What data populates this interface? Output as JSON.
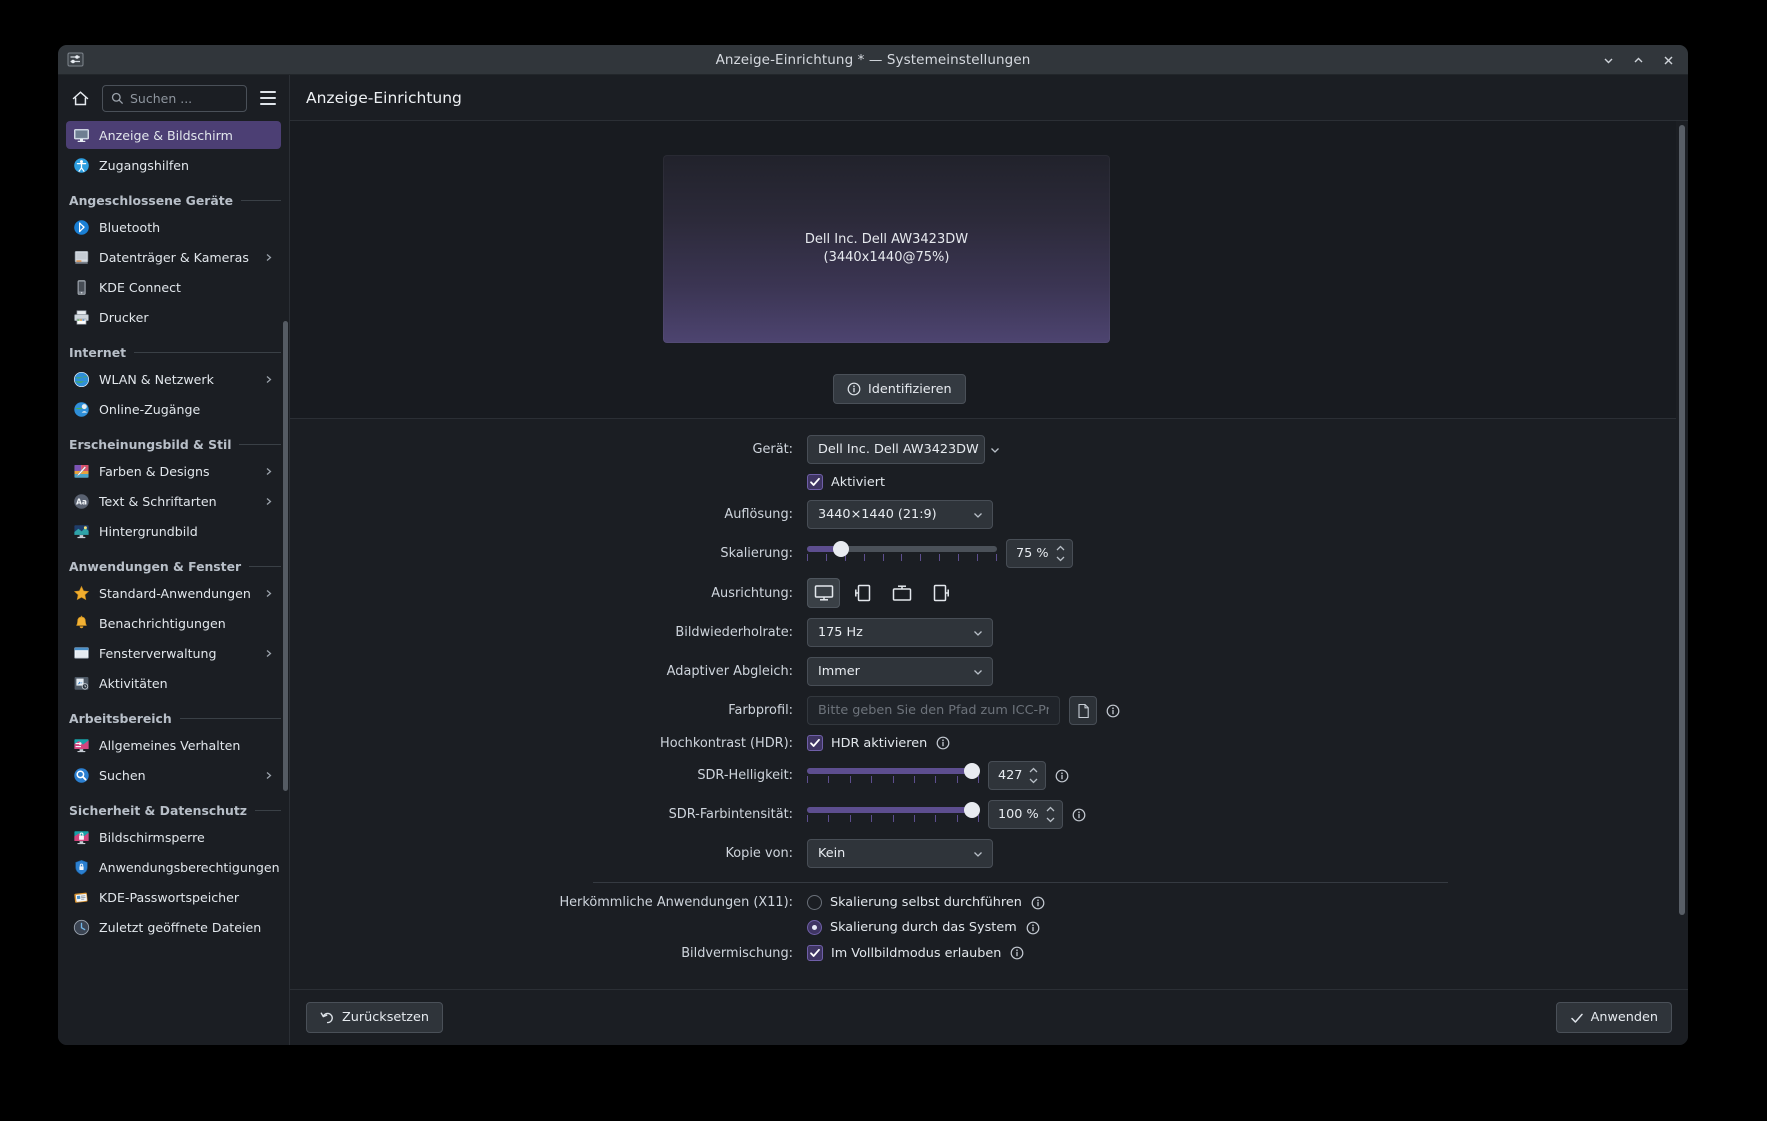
{
  "window": {
    "title": "Anzeige-Einrichtung * — Systemeinstellungen",
    "app_icon": "settings-sliders-icon",
    "controls": {
      "minimize": "minimize-icon",
      "maximize": "maximize-icon",
      "close": "close-icon"
    }
  },
  "sidebar": {
    "home_icon": "home-icon",
    "search": {
      "placeholder": "Suchen ...",
      "icon": "search-icon"
    },
    "menu_icon": "hamburger-menu-icon",
    "groups": [
      {
        "label": null,
        "items": [
          {
            "label": "Anzeige & Bildschirm",
            "icon": "monitor-icon",
            "active": true,
            "chevron": false
          },
          {
            "label": "Zugangshilfen",
            "icon": "accessibility-icon",
            "active": false,
            "chevron": false
          }
        ]
      },
      {
        "label": "Angeschlossene Geräte",
        "items": [
          {
            "label": "Bluetooth",
            "icon": "bluetooth-icon",
            "active": false,
            "chevron": false
          },
          {
            "label": "Datenträger & Kameras",
            "icon": "removable-media-icon",
            "active": false,
            "chevron": true
          },
          {
            "label": "KDE Connect",
            "icon": "smartphone-icon",
            "active": false,
            "chevron": false
          },
          {
            "label": "Drucker",
            "icon": "printer-icon",
            "active": false,
            "chevron": false
          }
        ]
      },
      {
        "label": "Internet",
        "items": [
          {
            "label": "WLAN & Netzwerk",
            "icon": "globe-network-icon",
            "active": false,
            "chevron": true
          },
          {
            "label": "Online-Zugänge",
            "icon": "online-accounts-icon",
            "active": false,
            "chevron": false
          }
        ]
      },
      {
        "label": "Erscheinungsbild & Stil",
        "items": [
          {
            "label": "Farben & Designs",
            "icon": "color-palette-icon",
            "active": false,
            "chevron": true
          },
          {
            "label": "Text & Schriftarten",
            "icon": "font-aa-icon",
            "active": false,
            "chevron": true
          },
          {
            "label": "Hintergrundbild",
            "icon": "wallpaper-icon",
            "active": false,
            "chevron": false
          }
        ]
      },
      {
        "label": "Anwendungen & Fenster",
        "items": [
          {
            "label": "Standard-Anwendungen",
            "icon": "star-icon",
            "active": false,
            "chevron": true
          },
          {
            "label": "Benachrichtigungen",
            "icon": "bell-icon",
            "active": false,
            "chevron": false
          },
          {
            "label": "Fensterverwaltung",
            "icon": "window-icon",
            "active": false,
            "chevron": true
          },
          {
            "label": "Aktivitäten",
            "icon": "activities-icon",
            "active": false,
            "chevron": false
          }
        ]
      },
      {
        "label": "Arbeitsbereich",
        "items": [
          {
            "label": "Allgemeines Verhalten",
            "icon": "workspace-behavior-icon",
            "active": false,
            "chevron": false
          },
          {
            "label": "Suchen",
            "icon": "magnifier-icon",
            "active": false,
            "chevron": true
          }
        ]
      },
      {
        "label": "Sicherheit & Datenschutz",
        "items": [
          {
            "label": "Bildschirmsperre",
            "icon": "screen-lock-icon",
            "active": false,
            "chevron": false
          },
          {
            "label": "Anwendungsberechtigungen",
            "icon": "shield-lock-icon",
            "active": false,
            "chevron": false
          },
          {
            "label": "KDE-Passwortspeicher",
            "icon": "wallet-icon",
            "active": false,
            "chevron": false
          },
          {
            "label": "Zuletzt geöffnete Dateien",
            "icon": "recent-clock-icon",
            "active": false,
            "chevron": false
          }
        ]
      }
    ]
  },
  "main": {
    "page_title": "Anzeige-Einrichtung",
    "preview": {
      "monitor_name": "Dell Inc. Dell AW3423DW",
      "monitor_mode": "(3440x1440@75%)"
    },
    "identify_button": {
      "label": "Identifizieren",
      "icon": "info-circle-icon"
    },
    "form": {
      "device": {
        "label": "Gerät:",
        "value": "Dell Inc. Dell AW3423DW"
      },
      "enabled": {
        "label": "Aktiviert",
        "checked": true
      },
      "resolution": {
        "label": "Auflösung:",
        "value": "3440×1440 (21:9)"
      },
      "scaling": {
        "label": "Skalierung:",
        "value": "75 %",
        "percent": 18,
        "ticks": 11
      },
      "orientation": {
        "label": "Ausrichtung:",
        "selected": 0,
        "options": [
          "rotate-0-landscape-icon",
          "rotate-90-portrait-icon",
          "rotate-180-landscape-icon",
          "rotate-270-portrait-icon"
        ]
      },
      "refresh_rate": {
        "label": "Bildwiederholrate:",
        "value": "175 Hz"
      },
      "adaptive_sync": {
        "label": "Adaptiver Abgleich:",
        "value": "Immer"
      },
      "color_profile": {
        "label": "Farbprofil:",
        "placeholder": "Bitte geben Sie den Pfad zum ICC-Profil an ...",
        "browse_icon": "file-browse-icon",
        "info_icon": "info-circle-icon"
      },
      "hdr": {
        "label": "Hochkontrast (HDR):",
        "checkbox_label": "HDR aktivieren",
        "checked": true,
        "info_icon": "info-circle-icon"
      },
      "sdr_brightness": {
        "label": "SDR-Helligkeit:",
        "value": "427",
        "percent": 96,
        "ticks": 9,
        "info_icon": "info-circle-icon"
      },
      "sdr_saturation": {
        "label": "SDR-Farbintensität:",
        "value": "100 %",
        "percent": 96,
        "ticks": 9,
        "info_icon": "info-circle-icon"
      },
      "replica_of": {
        "label": "Kopie von:",
        "value": "Kein"
      },
      "legacy_apps": {
        "label": "Herkömmliche Anwendungen (X11):",
        "option_self": {
          "label": "Skalierung selbst durchführen",
          "selected": false,
          "info_icon": "info-circle-icon"
        },
        "option_system": {
          "label": "Skalierung durch das System",
          "selected": true,
          "info_icon": "info-circle-icon"
        }
      },
      "tearing": {
        "label": "Bildvermischung:",
        "checkbox_label": "Im Vollbildmodus erlauben",
        "checked": true,
        "info_icon": "info-circle-icon"
      }
    }
  },
  "footer": {
    "reset": {
      "label": "Zurücksetzen",
      "icon": "undo-arrow-icon"
    },
    "apply": {
      "label": "Anwenden",
      "icon": "checkmark-icon"
    }
  },
  "colors": {
    "accent": "#5d4e8f",
    "selection": "#4c3f74",
    "window_bg": "#1b1e23",
    "titlebar_bg": "#31363b",
    "text": "#e2e7ec"
  }
}
